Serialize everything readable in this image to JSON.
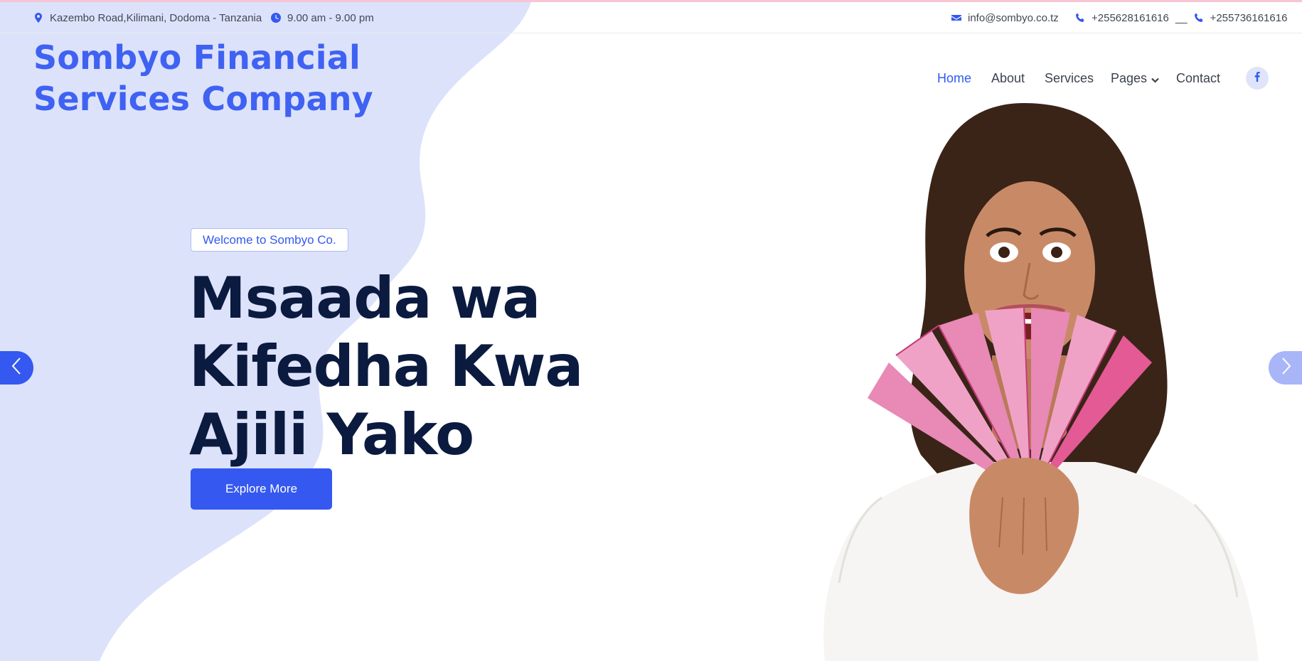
{
  "topbar": {
    "address": "Kazembo Road,Kilimani, Dodoma - Tanzania",
    "hours": "9.00 am - 9.00 pm",
    "email": "info@sombyo.co.tz",
    "phone1": "+255628161616",
    "phone_sep": "__",
    "phone2": "+255736161616",
    "icons": {
      "address": "map-marker-icon",
      "hours": "clock-icon",
      "email": "envelope-icon",
      "phone": "phone-icon"
    }
  },
  "brand": {
    "line1": "Sombyo Financial",
    "line2": "Services Company"
  },
  "nav": {
    "items": [
      "Home",
      "About",
      "Services",
      "Pages",
      "Contact"
    ],
    "active": "Home",
    "social_icon": "facebook-icon"
  },
  "hero": {
    "welcome": "Welcome to Sombyo Co.",
    "title_lines": [
      "Msaada wa",
      "Kifedha Kwa",
      "Ajili Yako"
    ],
    "cta": "Explore More",
    "image": "smiling woman holding fan of pink banknotes"
  },
  "carousel": {
    "prev_icon": "chevron-left-icon",
    "next_icon": "chevron-right-icon"
  },
  "colors": {
    "brand": "#3f62f2",
    "accent": "#3458f0",
    "wave": "#dde2fb",
    "heading": "#0b1a3f",
    "text": "#404854"
  }
}
